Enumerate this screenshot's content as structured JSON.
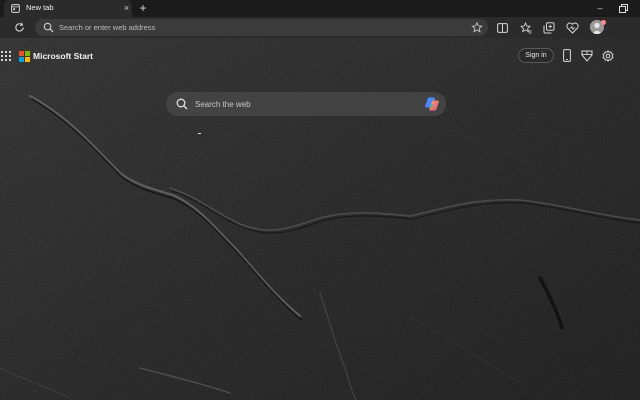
{
  "tab": {
    "title": "New tab",
    "favicon": "newtab-icon",
    "close_glyph": "×"
  },
  "tabstrip": {
    "new_tab_glyph": "+"
  },
  "window": {
    "minimize_glyph": "–"
  },
  "address_bar": {
    "placeholder": "Search or enter web address",
    "value": ""
  },
  "toolbar_icons": [
    "refresh-icon",
    "split-screen-icon",
    "favorites-icon",
    "collections-icon",
    "browser-essentials-icon",
    "profile-avatar"
  ],
  "brand": {
    "name": "Microsoft Start",
    "logo_colors": [
      "#f25022",
      "#7fba00",
      "#00a4ef",
      "#ffb900"
    ]
  },
  "header": {
    "signin_label": "Sign in",
    "icons": [
      "mobile-icon",
      "rewards-icon",
      "settings-gear-icon"
    ]
  },
  "search": {
    "placeholder": "Search the web",
    "value": "",
    "copilot_icon": "copilot-icon"
  },
  "colors": {
    "background": "#1e1e1e",
    "toolbar": "#2b2b2b",
    "address_bar": "#3b3b3b"
  }
}
